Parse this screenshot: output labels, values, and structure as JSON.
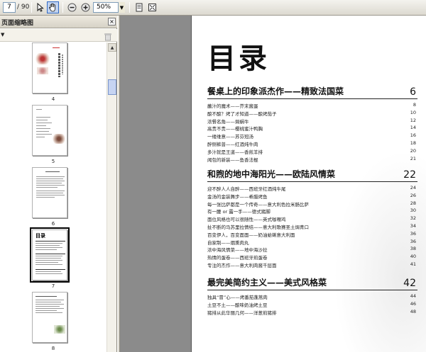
{
  "toolbar": {
    "page_current": "7",
    "page_total": "/ 90",
    "zoom": "50%"
  },
  "sidebar": {
    "title": "页面缩略图",
    "thumbnails": [
      {
        "label": "4"
      },
      {
        "label": "5"
      },
      {
        "label": "6"
      },
      {
        "label": "7"
      },
      {
        "label": "8"
      }
    ],
    "thumb7_title": "目录"
  },
  "document": {
    "title": "目录",
    "sections": [
      {
        "title": "餐桌上的印象派杰作——精致法国菜",
        "page": "6",
        "entries": [
          {
            "text": "蘸汁的魔术——芥末酱蛋",
            "page": "8"
          },
          {
            "text": "酿不酿？烤了才知道——酿烤茄子",
            "page": "10"
          },
          {
            "text": "浓餐名角——焗蜗牛",
            "page": "12"
          },
          {
            "text": "高贵不贵——樱桃蜜汁鸭胸",
            "page": "14"
          },
          {
            "text": "一缕维意——苏芬冠汤",
            "page": "16"
          },
          {
            "text": "醉侧裤普——红酒炖牛肉",
            "page": "18"
          },
          {
            "text": "多汁就是王道——香煎羊排",
            "page": "20"
          },
          {
            "text": "闻包的新装——鱼香法棍",
            "page": "21"
          }
        ]
      },
      {
        "title": "和煦的地中海阳光——欧陆风情菜",
        "page": "22",
        "entries": [
          {
            "text": "迎不醉人人自醉——西班牙红酒炖牛尾",
            "page": "24"
          },
          {
            "text": "金汤的金装舞步——希腊烤鱼",
            "page": "26"
          },
          {
            "text": "每一张比萨都是一个传奇——意大利色拉米肠比萨",
            "page": "28"
          },
          {
            "text": "有一腰 or 露一手——德式猪脚",
            "page": "30"
          },
          {
            "text": "面位风格也可以很随性——英式咖喱鸡",
            "page": "32"
          },
          {
            "text": "扯不断的马苏里拉情结——意大利歌赛圣土焗青口",
            "page": "34"
          },
          {
            "text": "百变伊人，百变面面——奶油蛤蜊意大利面",
            "page": "36"
          },
          {
            "text": "自家制——烟熏肉丸",
            "page": "36"
          },
          {
            "text": "浓中海风情菜——地中海沙拉",
            "page": "38"
          },
          {
            "text": "热情的蛋卷——西班牙煎蛋卷",
            "page": "40"
          },
          {
            "text": "专注的杰作——意大利肉酱千层面",
            "page": "41"
          }
        ]
      },
      {
        "title": "最完美简约主义——美式风格菜",
        "page": "42",
        "entries": [
          {
            "text": "独具“冒”心——烤番茄蓬蒿肉",
            "page": "44"
          },
          {
            "text": "土豆不土——酿味奶油烤土豆",
            "page": "46"
          },
          {
            "text": "猪排从此华丽几何——洋葱煎猪排",
            "page": "48"
          }
        ]
      }
    ]
  }
}
